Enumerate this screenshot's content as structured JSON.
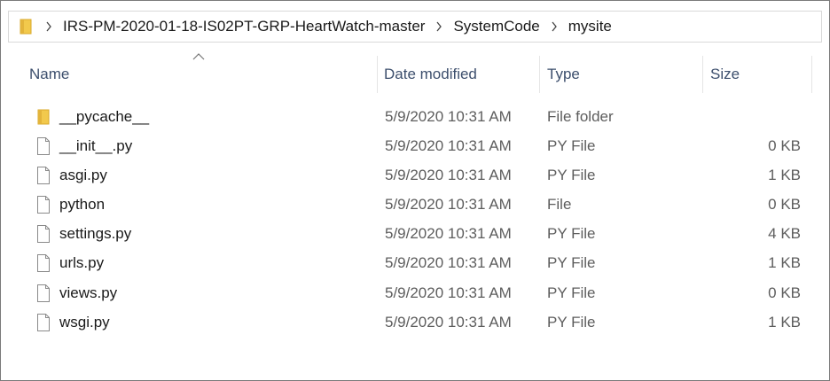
{
  "address_bar": {
    "breadcrumbs": [
      {
        "label": "IRS-PM-2020-01-18-IS02PT-GRP-HeartWatch-master"
      },
      {
        "label": "SystemCode"
      },
      {
        "label": "mysite"
      }
    ]
  },
  "columns": {
    "name": "Name",
    "date_modified": "Date modified",
    "type": "Type",
    "size": "Size",
    "sorted_by": "name",
    "sort_direction": "ascending"
  },
  "files": [
    {
      "name": "__pycache__",
      "date": "5/9/2020 10:31 AM",
      "type": "File folder",
      "size": "",
      "icon": "folder-icon"
    },
    {
      "name": "__init__.py",
      "date": "5/9/2020 10:31 AM",
      "type": "PY File",
      "size": "0 KB",
      "icon": "file-icon"
    },
    {
      "name": "asgi.py",
      "date": "5/9/2020 10:31 AM",
      "type": "PY File",
      "size": "1 KB",
      "icon": "file-icon"
    },
    {
      "name": "python",
      "date": "5/9/2020 10:31 AM",
      "type": "File",
      "size": "0 KB",
      "icon": "file-icon"
    },
    {
      "name": "settings.py",
      "date": "5/9/2020 10:31 AM",
      "type": "PY File",
      "size": "4 KB",
      "icon": "file-icon"
    },
    {
      "name": "urls.py",
      "date": "5/9/2020 10:31 AM",
      "type": "PY File",
      "size": "1 KB",
      "icon": "file-icon"
    },
    {
      "name": "views.py",
      "date": "5/9/2020 10:31 AM",
      "type": "PY File",
      "size": "0 KB",
      "icon": "file-icon"
    },
    {
      "name": "wsgi.py",
      "date": "5/9/2020 10:31 AM",
      "type": "PY File",
      "size": "1 KB",
      "icon": "file-icon"
    }
  ],
  "colors": {
    "folder": "#f2c94c",
    "header_text": "#3d4f6d",
    "secondary_text": "#5d5d5d"
  }
}
